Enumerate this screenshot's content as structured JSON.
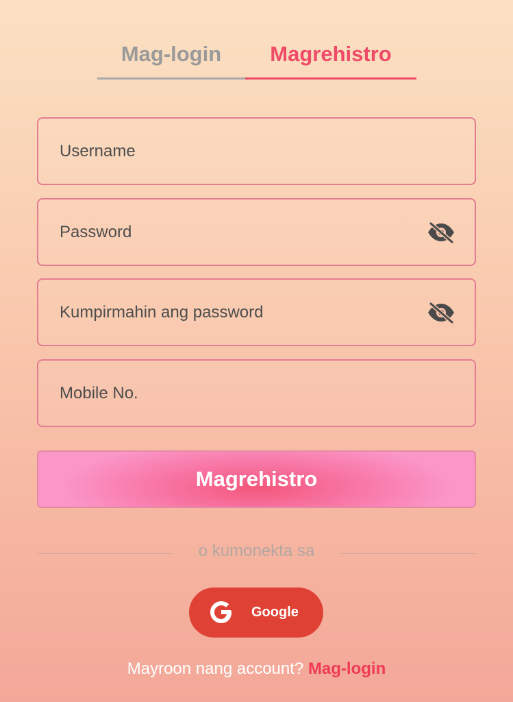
{
  "tabs": [
    {
      "label": "Mag-login",
      "active": false
    },
    {
      "label": "Magrehistro",
      "active": true
    }
  ],
  "fields": {
    "username": {
      "placeholder": "Username",
      "value": ""
    },
    "password": {
      "placeholder": "Password",
      "value": "",
      "icon": "eye-off-icon"
    },
    "confirm_password": {
      "placeholder": "Kumpirmahin ang password",
      "value": "",
      "icon": "eye-off-icon"
    },
    "mobile": {
      "placeholder": "Mobile No.",
      "value": ""
    }
  },
  "submit_label": "Magrehistro",
  "divider_text": "o kumonekta sa",
  "google": {
    "label": "Google",
    "icon": "google-icon"
  },
  "footer": {
    "prompt": "Mayroon nang account?",
    "link": "Mag-login"
  },
  "colors": {
    "accent": "#ef4a68",
    "google": "#df4234",
    "field_border": "#e47c92"
  }
}
